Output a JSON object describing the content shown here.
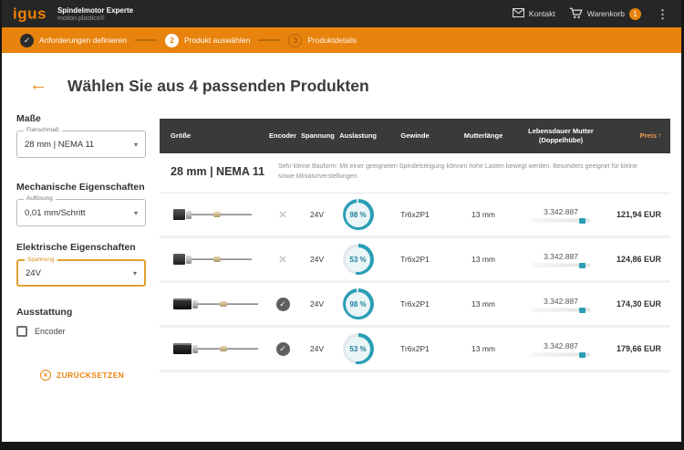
{
  "header": {
    "logo_text": "igus",
    "app_title": "Spindelmotor Experte",
    "app_subtitle": "motion plastics®",
    "kontakt_label": "Kontakt",
    "warenkorb_label": "Warenkorb",
    "cart_badge": "1"
  },
  "stepper": {
    "steps": [
      {
        "marker": "✓",
        "label": "Anforderungen definieren",
        "state": "done"
      },
      {
        "marker": "2",
        "label": "Produkt auswählen",
        "state": "active"
      },
      {
        "marker": "3",
        "label": "Produktdetails",
        "state": "upcoming"
      }
    ]
  },
  "page": {
    "title": "Wählen Sie aus 4 passenden Produkten"
  },
  "filters": {
    "masse_title": "Maße",
    "flanschmass": {
      "label": "Flanschmaß",
      "value": "28 mm | NEMA 11"
    },
    "mechanisch_title": "Mechanische Eigenschaften",
    "aufloesung": {
      "label": "Auflösung",
      "value": "0,01 mm/Schritt"
    },
    "elektrisch_title": "Elektrische Eigenschaften",
    "spannung": {
      "label": "Spannung",
      "value": "24V"
    },
    "ausstattung_title": "Ausstattung",
    "encoder_checkbox_label": "Encoder",
    "encoder_checked": false,
    "reset_label": "ZURÜCKSETZEN"
  },
  "results": {
    "columns": [
      "Größe",
      "Encoder",
      "Spannung",
      "Auslastung",
      "Gewinde",
      "Mutterlänge",
      "Lebensdauer Mutter (Doppelhübe)",
      "Preis"
    ],
    "sort": {
      "column": "Preis",
      "direction": "ascending"
    },
    "group_title": "28 mm | NEMA 11",
    "group_description": "Sehr kleine Bauform: Mit einer geeigneten Spindelsteigung können hohe Lasten bewegt werden. Besonders geeignet für kleine sowie Miniaturverstellungen.",
    "rows": [
      {
        "has_encoder": false,
        "voltage": "24V",
        "load_pct": 98,
        "load_label": "98 %",
        "thread": "Tr6x2P1",
        "nut_length": "13 mm",
        "lifetime_cycles": "3.342.887",
        "price": "121,94 EUR"
      },
      {
        "has_encoder": false,
        "voltage": "24V",
        "load_pct": 53,
        "load_label": "53 %",
        "thread": "Tr6x2P1",
        "nut_length": "13 mm",
        "lifetime_cycles": "3.342.887",
        "price": "124,86 EUR"
      },
      {
        "has_encoder": true,
        "voltage": "24V",
        "load_pct": 98,
        "load_label": "98 %",
        "thread": "Tr6x2P1",
        "nut_length": "13 mm",
        "lifetime_cycles": "3.342.887",
        "price": "174,30 EUR"
      },
      {
        "has_encoder": true,
        "voltage": "24V",
        "load_pct": 53,
        "load_label": "53 %",
        "thread": "Tr6x2P1",
        "nut_length": "13 mm",
        "lifetime_cycles": "3.342.887",
        "price": "179,66 EUR"
      }
    ]
  },
  "icons": {
    "back": "←",
    "sort_asc": "↑",
    "check": "✓",
    "cross": "✕",
    "menu_dots": "⋮",
    "caret": "▾",
    "reset_cross": "✕"
  },
  "colors": {
    "brand_orange": "#E8830D",
    "accent_teal": "#2B9EB6",
    "header_dark": "#262626",
    "table_header_dark": "#3A3A3A",
    "highlight_border": "#DFA02F"
  }
}
